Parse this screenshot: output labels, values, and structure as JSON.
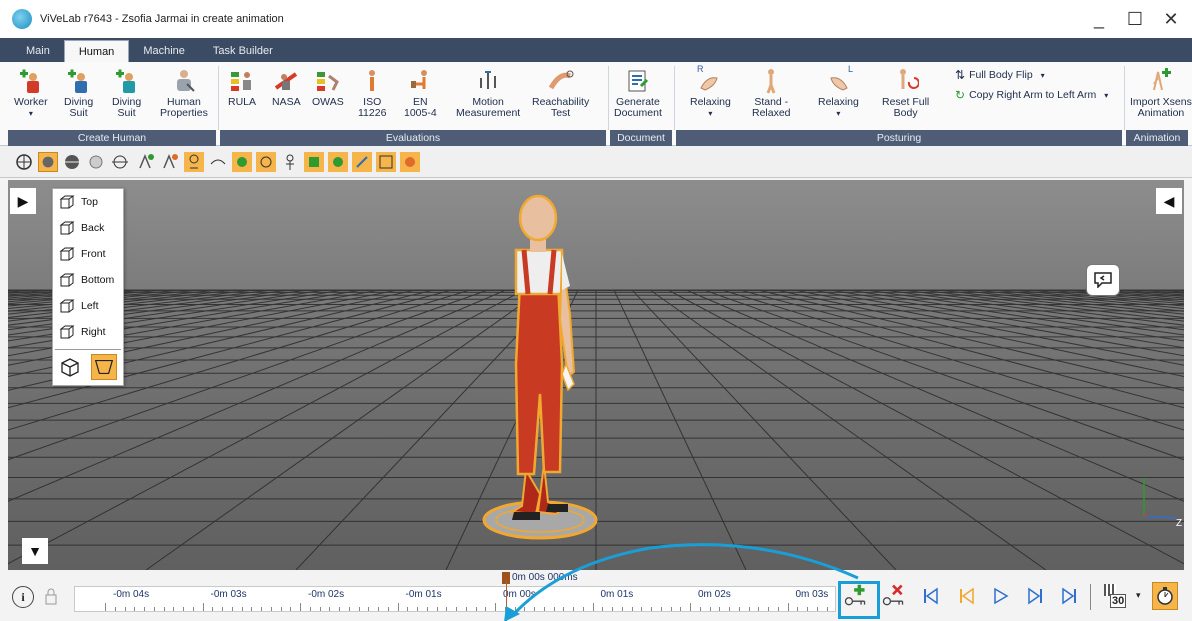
{
  "window": {
    "title": "ViVeLab r7643 - Zsofia Jarmai in create animation"
  },
  "tabs": [
    "Main",
    "Human",
    "Machine",
    "Task Builder"
  ],
  "ribbon": {
    "buttons": [
      {
        "label": "Worker",
        "icon": "worker-add-icon"
      },
      {
        "label": "Diving\nSuit",
        "icon": "diving-suit-add-icon"
      },
      {
        "label": "Diving\nSuit",
        "icon": "diving-suit-add-icon-2"
      },
      {
        "label": "Human\nProperties",
        "icon": "human-properties-icon"
      },
      {
        "label": "RULA",
        "icon": "rula-icon"
      },
      {
        "label": "NASA",
        "icon": "nasa-icon"
      },
      {
        "label": "OWAS",
        "icon": "owas-icon"
      },
      {
        "label": "ISO\n11226",
        "icon": "iso-icon"
      },
      {
        "label": "EN\n1005-4",
        "icon": "en-icon"
      },
      {
        "label": "Motion\nMeasurement",
        "icon": "motion-measurement-icon"
      },
      {
        "label": "Reachability\nTest",
        "icon": "reachability-icon"
      },
      {
        "label": "Generate\nDocument",
        "icon": "generate-document-icon"
      },
      {
        "label": "Relaxing",
        "icon": "relaxing-right-hand-icon"
      },
      {
        "label": "Stand -\nRelaxed",
        "icon": "stand-relaxed-icon"
      },
      {
        "label": "Relaxing",
        "icon": "relaxing-left-hand-icon"
      },
      {
        "label": "Reset Full\nBody",
        "icon": "reset-body-icon"
      },
      {
        "label": "Import Xsens\nAnimation",
        "icon": "import-xsens-icon"
      }
    ],
    "small_commands": [
      "Full Body Flip",
      "Copy Right Arm to Left Arm"
    ],
    "groups": [
      "Create Human",
      "Evaluations",
      "Document",
      "Posturing",
      "Animation"
    ],
    "hand_letters": [
      "R",
      "L"
    ]
  },
  "view_menu": [
    "Top",
    "Back",
    "Front",
    "Bottom",
    "Left",
    "Right"
  ],
  "axis": {
    "z_label": "Z"
  },
  "timeline": {
    "cursor_label": "0m 00s 000ms",
    "ticks": [
      "-0m 04s",
      "-0m 03s",
      "-0m 02s",
      "-0m 01s",
      "0m 00s",
      "0m 01s",
      "0m 02s",
      "0m 03s"
    ],
    "fps": "30"
  },
  "colors": {
    "accent": "#1a9ed8",
    "tab_bar": "#3b4b64",
    "group_bar": "#4e5d75",
    "highlight": "#f0a830"
  }
}
